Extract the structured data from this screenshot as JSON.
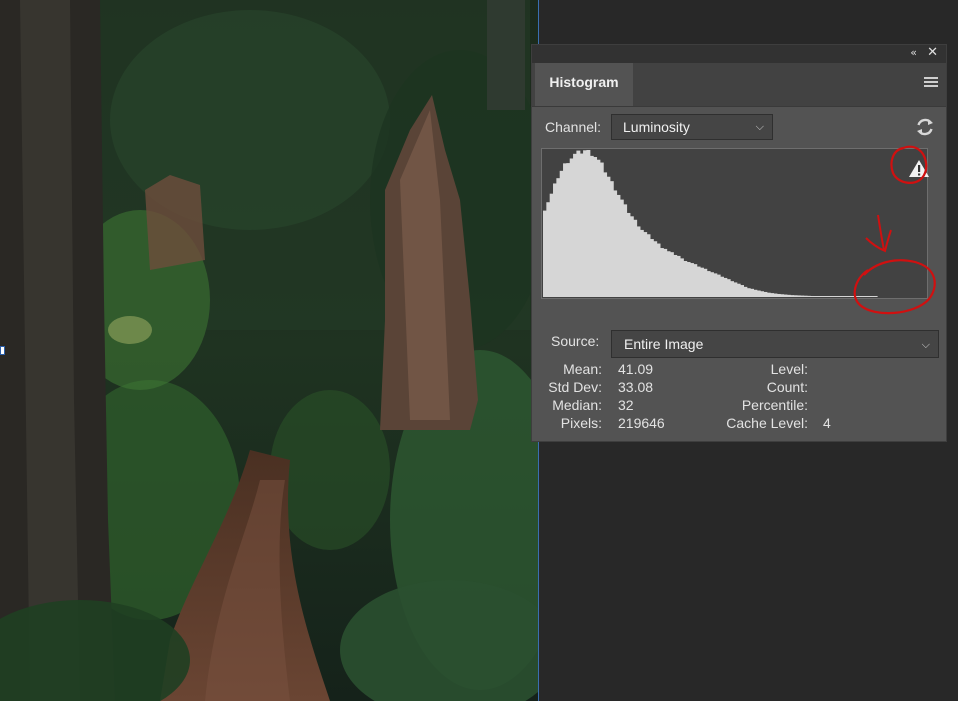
{
  "panel": {
    "collapse_icon": "«",
    "close_icon": "✕",
    "tab_label": "Histogram",
    "channel_label": "Channel:",
    "channel_value": "Luminosity",
    "source_label": "Source:",
    "source_value": "Entire Image"
  },
  "stats": {
    "mean_label": "Mean:",
    "mean_value": "41.09",
    "stddev_label": "Std Dev:",
    "stddev_value": "33.08",
    "median_label": "Median:",
    "median_value": "32",
    "pixels_label": "Pixels:",
    "pixels_value": "219646",
    "level_label": "Level:",
    "level_value": "",
    "count_label": "Count:",
    "count_value": "",
    "percentile_label": "Percentile:",
    "percentile_value": "",
    "cache_label": "Cache Level:",
    "cache_value": "4"
  },
  "icons": {
    "chevron": "⌵",
    "warning": "warning-triangle-icon",
    "refresh": "refresh-icon",
    "menu": "hamburger-menu-icon"
  },
  "colors": {
    "panel_bg": "#535353",
    "histogram_fill": "#d6d6d6",
    "annotation_red": "#d01010",
    "canvas_bg": "#282828"
  },
  "chart_data": {
    "type": "area",
    "x_range": [
      0,
      255
    ],
    "peak_level": 30,
    "values": [
      0.6,
      0.65,
      0.7,
      0.76,
      0.82,
      0.86,
      0.9,
      0.93,
      0.95,
      0.97,
      0.98,
      0.99,
      1.0,
      0.99,
      0.98,
      0.96,
      0.93,
      0.9,
      0.86,
      0.82,
      0.78,
      0.74,
      0.7,
      0.66,
      0.62,
      0.58,
      0.55,
      0.52,
      0.49,
      0.46,
      0.44,
      0.42,
      0.4,
      0.38,
      0.36,
      0.34,
      0.33,
      0.31,
      0.3,
      0.29,
      0.28,
      0.26,
      0.25,
      0.24,
      0.23,
      0.22,
      0.21,
      0.2,
      0.19,
      0.18,
      0.17,
      0.16,
      0.15,
      0.14,
      0.13,
      0.12,
      0.11,
      0.1,
      0.09,
      0.08,
      0.07,
      0.06,
      0.055,
      0.05,
      0.045,
      0.04,
      0.035,
      0.03,
      0.027,
      0.024,
      0.021,
      0.019,
      0.017,
      0.015,
      0.013,
      0.012,
      0.011,
      0.01,
      0.009,
      0.008,
      0.007,
      0.006,
      0.006,
      0.005,
      0.005,
      0.004,
      0.004,
      0.003,
      0.003,
      0.003,
      0.002,
      0.002,
      0.002,
      0.002,
      0.001,
      0.001,
      0.001,
      0.001,
      0.001,
      0.001
    ]
  }
}
